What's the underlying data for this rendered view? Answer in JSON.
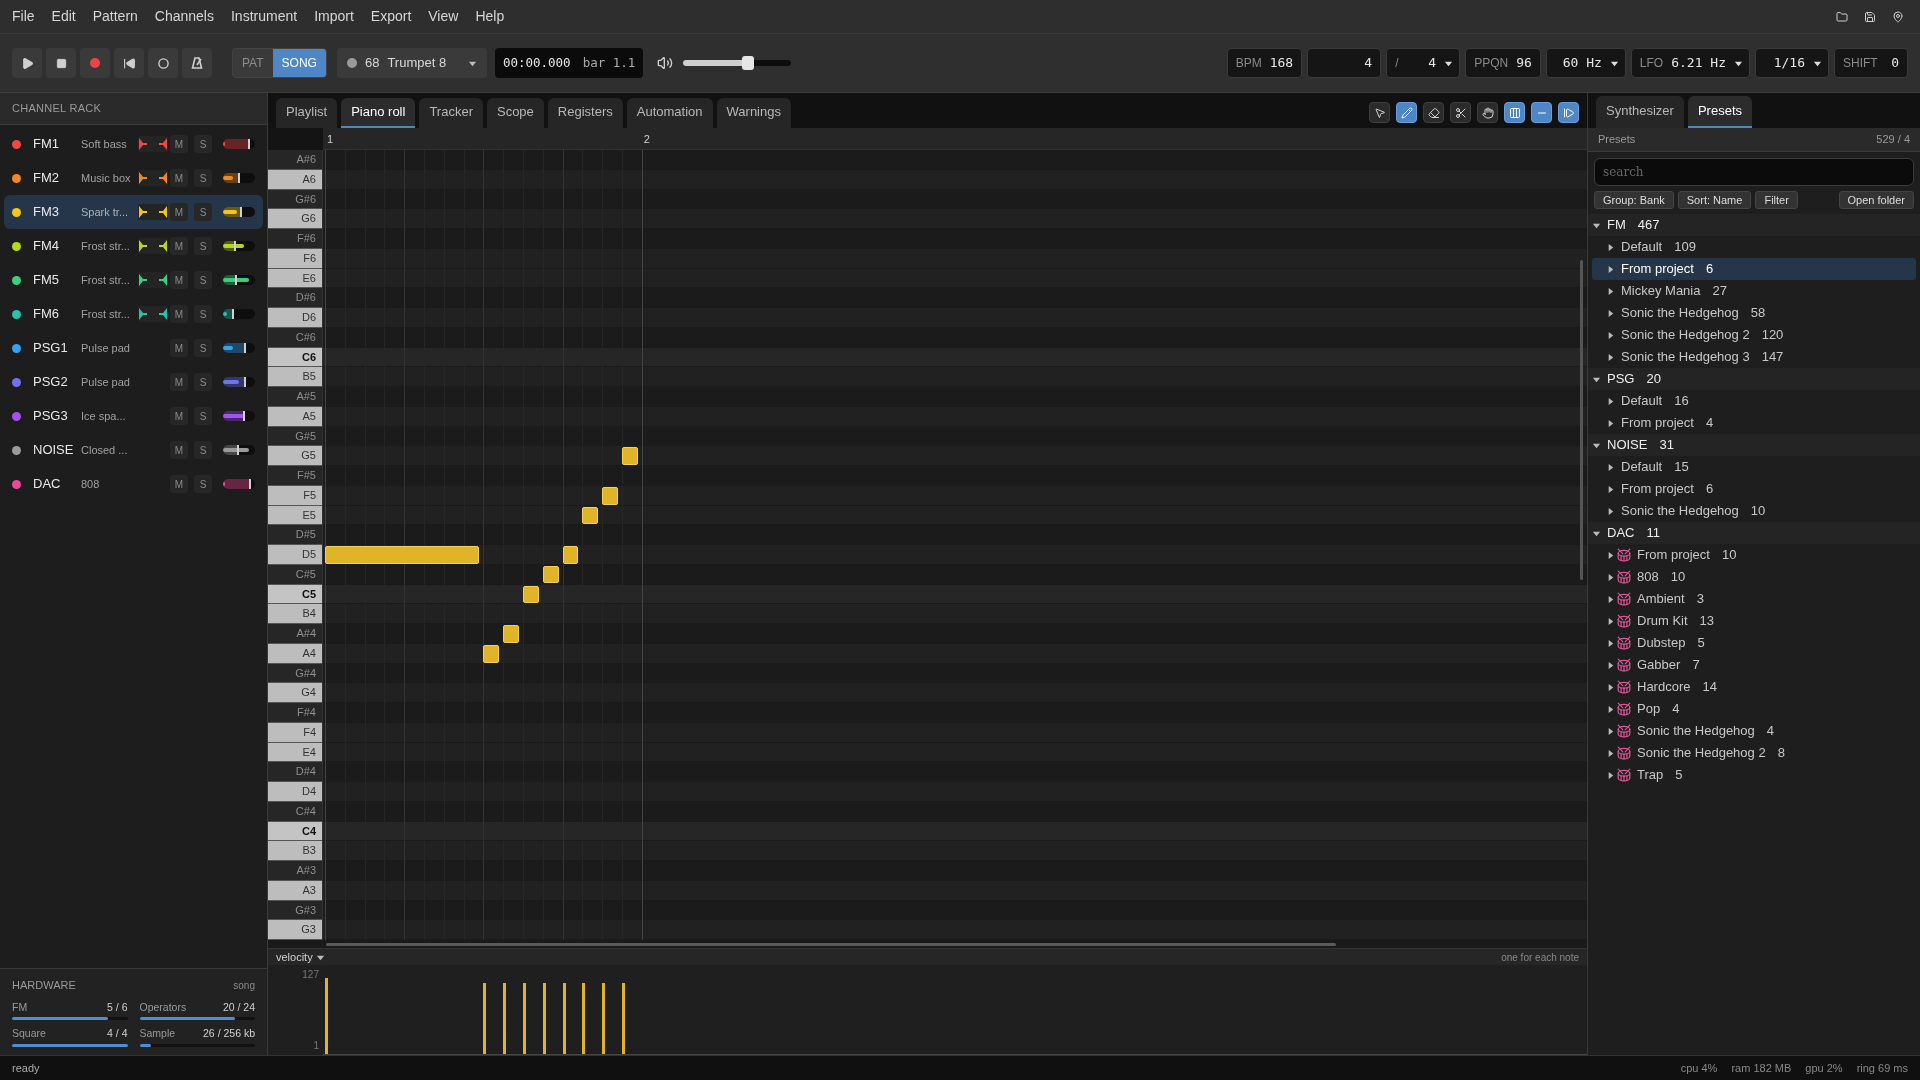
{
  "menu": [
    "File",
    "Edit",
    "Pattern",
    "Channels",
    "Instrument",
    "Import",
    "Export",
    "View",
    "Help"
  ],
  "transport": {
    "mode": [
      {
        "label": "PAT",
        "selected": false
      },
      {
        "label": "SONG",
        "selected": true
      }
    ],
    "instrument": {
      "number": "68",
      "name": "Trumpet 8"
    },
    "time": "00:00.000",
    "bar": "bar 1.1",
    "volume": {
      "level": 0.6
    }
  },
  "settings": [
    {
      "label": "BPM",
      "value": "168",
      "dropdown": false
    },
    {
      "value": "4",
      "dropdown": false
    },
    {
      "label": "/",
      "value": "4",
      "dropdown": true
    },
    {
      "label": "PPQN",
      "value": "96",
      "dropdown": false
    },
    {
      "value": "60 Hz",
      "dropdown": true
    },
    {
      "label": "LFO",
      "value": "6.21 Hz",
      "dropdown": true
    },
    {
      "value": "1/16",
      "dropdown": true
    },
    {
      "label": "SHIFT",
      "value": "0",
      "dropdown": false
    }
  ],
  "channel_rack": {
    "title": "CHANNEL RACK",
    "channels": [
      {
        "name": "FM1",
        "instrument": "Soft bass",
        "color": "#f04848",
        "kind": "fm",
        "selected": false,
        "mute": {
          "label": "M",
          "on": false
        },
        "solo": {
          "label": "S",
          "on": false
        },
        "volume": {
          "level": 0.8
        },
        "meter": {
          "level": 0.06
        }
      },
      {
        "name": "FM2",
        "instrument": "Music box",
        "color": "#f08a24",
        "kind": "fm",
        "selected": false,
        "mute": {
          "label": "M",
          "on": false
        },
        "solo": {
          "label": "S",
          "on": false
        },
        "volume": {
          "level": 0.5
        },
        "meter": {
          "level": 0.3
        }
      },
      {
        "name": "FM3",
        "instrument": "Spark tr...",
        "color": "#f5c518",
        "kind": "fm",
        "selected": true,
        "mute": {
          "label": "M",
          "on": false
        },
        "solo": {
          "label": "S",
          "on": false
        },
        "volume": {
          "level": 0.55
        },
        "meter": {
          "level": 0.45
        }
      },
      {
        "name": "FM4",
        "instrument": "Frost str...",
        "color": "#b5d91f",
        "kind": "fm",
        "selected": false,
        "mute": {
          "label": "M",
          "on": false
        },
        "solo": {
          "label": "S",
          "on": false
        },
        "volume": {
          "level": 0.37
        },
        "meter": {
          "level": 0.65
        }
      },
      {
        "name": "FM5",
        "instrument": "Frost str...",
        "color": "#3ecf7e",
        "kind": "fm",
        "selected": false,
        "mute": {
          "label": "M",
          "on": false
        },
        "solo": {
          "label": "S",
          "on": false
        },
        "volume": {
          "level": 0.4
        },
        "meter": {
          "level": 0.8
        }
      },
      {
        "name": "FM6",
        "instrument": "Frost str...",
        "color": "#2bbfae",
        "kind": "fm",
        "selected": false,
        "mute": {
          "label": "M",
          "on": false
        },
        "solo": {
          "label": "S",
          "on": false
        },
        "volume": {
          "level": 0.3
        },
        "meter": {
          "level": 0.12
        }
      },
      {
        "name": "PSG1",
        "instrument": "Pulse pad",
        "color": "#36a3ef",
        "kind": "psg",
        "selected": false,
        "mute": {
          "label": "M",
          "on": false
        },
        "solo": {
          "label": "S",
          "on": false
        },
        "volume": {
          "level": 0.7
        },
        "meter": {
          "level": 0.3
        }
      },
      {
        "name": "PSG2",
        "instrument": "Pulse pad",
        "color": "#6c74ef",
        "kind": "psg",
        "selected": false,
        "mute": {
          "label": "M",
          "on": false
        },
        "solo": {
          "label": "S",
          "on": false
        },
        "volume": {
          "level": 0.7
        },
        "meter": {
          "level": 0.5
        }
      },
      {
        "name": "PSG3",
        "instrument": "Ice spa...",
        "color": "#a352ef",
        "kind": "psg",
        "selected": false,
        "mute": {
          "label": "M",
          "on": false
        },
        "solo": {
          "label": "S",
          "on": false
        },
        "volume": {
          "level": 0.65
        },
        "meter": {
          "level": 0.65
        }
      },
      {
        "name": "NOISE",
        "instrument": "Closed ...",
        "color": "#9a9a9a",
        "kind": "psg",
        "selected": false,
        "mute": {
          "label": "M",
          "on": false
        },
        "solo": {
          "label": "S",
          "on": false
        },
        "volume": {
          "level": 0.47
        },
        "meter": {
          "level": 0.8
        }
      },
      {
        "name": "DAC",
        "instrument": "808",
        "color": "#ec4899",
        "kind": "psg",
        "selected": false,
        "mute": {
          "label": "M",
          "on": false
        },
        "solo": {
          "label": "S",
          "on": false
        },
        "volume": {
          "level": 0.85
        },
        "meter": {
          "level": 0.06
        }
      }
    ]
  },
  "hardware": {
    "title": "HARDWARE",
    "mode": "song",
    "stats": [
      {
        "label": "FM",
        "value": "5 / 6",
        "level": 0.83
      },
      {
        "label": "Operators",
        "value": "20 / 24",
        "level": 0.83
      },
      {
        "label": "Square",
        "value": "4 / 4",
        "level": 1
      },
      {
        "label": "Sample",
        "value": "26 / 256 kb",
        "level": 0.1
      }
    ]
  },
  "editor_tabs": [
    {
      "label": "Playlist",
      "selected": false
    },
    {
      "label": "Piano roll",
      "selected": true
    },
    {
      "label": "Tracker",
      "selected": false
    },
    {
      "label": "Scope",
      "selected": false
    },
    {
      "label": "Registers",
      "selected": false
    },
    {
      "label": "Automation",
      "selected": false
    },
    {
      "label": "Warnings",
      "selected": false
    }
  ],
  "tools": [
    {
      "kind": "pointer",
      "selected": false
    },
    {
      "kind": "pencil",
      "selected": true
    },
    {
      "kind": "eraser",
      "selected": false
    },
    {
      "kind": "cut",
      "selected": false
    },
    {
      "kind": "hand",
      "selected": false
    },
    {
      "kind": "columns",
      "selected": true
    },
    {
      "kind": "strip",
      "selected": true
    },
    {
      "kind": "follow",
      "selected": true
    }
  ],
  "ruler": [
    "1",
    "2"
  ],
  "keys": [
    {
      "name": "A#6",
      "kind": "black"
    },
    {
      "name": "A6",
      "kind": "white"
    },
    {
      "name": "G#6",
      "kind": "black"
    },
    {
      "name": "G6",
      "kind": "white"
    },
    {
      "name": "F#6",
      "kind": "black"
    },
    {
      "name": "F6",
      "kind": "white"
    },
    {
      "name": "E6",
      "kind": "white"
    },
    {
      "name": "D#6",
      "kind": "black"
    },
    {
      "name": "D6",
      "kind": "white"
    },
    {
      "name": "C#6",
      "kind": "black"
    },
    {
      "name": "C6",
      "kind": "octave"
    },
    {
      "name": "B5",
      "kind": "white"
    },
    {
      "name": "A#5",
      "kind": "black"
    },
    {
      "name": "A5",
      "kind": "white"
    },
    {
      "name": "G#5",
      "kind": "black"
    },
    {
      "name": "G5",
      "kind": "white"
    },
    {
      "name": "F#5",
      "kind": "black"
    },
    {
      "name": "F5",
      "kind": "white"
    },
    {
      "name": "E5",
      "kind": "white"
    },
    {
      "name": "D#5",
      "kind": "black"
    },
    {
      "name": "D5",
      "kind": "white"
    },
    {
      "name": "C#5",
      "kind": "black"
    },
    {
      "name": "C5",
      "kind": "octave"
    },
    {
      "name": "B4",
      "kind": "white"
    },
    {
      "name": "A#4",
      "kind": "black"
    },
    {
      "name": "A4",
      "kind": "white"
    },
    {
      "name": "G#4",
      "kind": "black"
    },
    {
      "name": "G4",
      "kind": "white"
    },
    {
      "name": "F#4",
      "kind": "black"
    },
    {
      "name": "F4",
      "kind": "white"
    },
    {
      "name": "E4",
      "kind": "white"
    },
    {
      "name": "D#4",
      "kind": "black"
    },
    {
      "name": "D4",
      "kind": "white"
    },
    {
      "name": "C#4",
      "kind": "black"
    },
    {
      "name": "C4",
      "kind": "octave"
    },
    {
      "name": "B3",
      "kind": "white"
    },
    {
      "name": "A#3",
      "kind": "black"
    },
    {
      "name": "A3",
      "kind": "white"
    },
    {
      "name": "G#3",
      "kind": "black"
    },
    {
      "name": "G3",
      "kind": "white"
    }
  ],
  "velocity": {
    "label": "velocity",
    "hint": "one for each note",
    "ymax": "127",
    "ymin": "1"
  },
  "side_tabs": [
    {
      "label": "Synthesizer",
      "selected": false
    },
    {
      "label": "Presets",
      "selected": true
    }
  ],
  "presets": {
    "title": "Presets",
    "count": "529 / 4",
    "search": {
      "placeholder": "search"
    },
    "buttons": [
      "Group: Bank",
      "Sort: Name",
      "Filter"
    ],
    "open_folder": "Open folder",
    "groups": [
      {
        "name": "FM",
        "count": "467",
        "expanded": true,
        "children": [
          {
            "name": "Default",
            "count": "109",
            "kind": "bank",
            "selected": false
          },
          {
            "name": "From project",
            "count": "6",
            "kind": "bank",
            "selected": true
          },
          {
            "name": "Mickey Mania",
            "count": "27",
            "kind": "bank",
            "selected": false
          },
          {
            "name": "Sonic the Hedgehog",
            "count": "58",
            "kind": "bank",
            "selected": false
          },
          {
            "name": "Sonic the Hedgehog 2",
            "count": "120",
            "kind": "bank",
            "selected": false
          },
          {
            "name": "Sonic the Hedgehog 3",
            "count": "147",
            "kind": "bank",
            "selected": false
          }
        ]
      },
      {
        "name": "PSG",
        "count": "20",
        "expanded": true,
        "children": [
          {
            "name": "Default",
            "count": "16",
            "kind": "bank",
            "selected": false
          },
          {
            "name": "From project",
            "count": "4",
            "kind": "bank",
            "selected": false
          }
        ]
      },
      {
        "name": "NOISE",
        "count": "31",
        "expanded": true,
        "children": [
          {
            "name": "Default",
            "count": "15",
            "kind": "bank",
            "selected": false
          },
          {
            "name": "From project",
            "count": "6",
            "kind": "bank",
            "selected": false
          },
          {
            "name": "Sonic the Hedgehog",
            "count": "10",
            "kind": "bank",
            "selected": false
          }
        ]
      },
      {
        "name": "DAC",
        "count": "11",
        "expanded": true,
        "children": [
          {
            "name": "From project",
            "count": "10",
            "kind": "drums",
            "selected": false
          },
          {
            "name": "808",
            "count": "10",
            "kind": "drums",
            "selected": false
          },
          {
            "name": "Ambient",
            "count": "3",
            "kind": "drums",
            "selected": false
          },
          {
            "name": "Drum Kit",
            "count": "13",
            "kind": "drums",
            "selected": false
          },
          {
            "name": "Dubstep",
            "count": "5",
            "kind": "drums",
            "selected": false
          },
          {
            "name": "Gabber",
            "count": "7",
            "kind": "drums",
            "selected": false
          },
          {
            "name": "Hardcore",
            "count": "14",
            "kind": "drums",
            "selected": false
          },
          {
            "name": "Pop",
            "count": "4",
            "kind": "drums",
            "selected": false
          },
          {
            "name": "Sonic the Hedgehog",
            "count": "4",
            "kind": "drums",
            "selected": false
          },
          {
            "name": "Sonic the Hedgehog 2",
            "count": "8",
            "kind": "drums",
            "selected": false
          },
          {
            "name": "Trap",
            "count": "5",
            "kind": "drums",
            "selected": false
          }
        ]
      }
    ]
  },
  "status_bar": {
    "message": "ready",
    "stats": [
      "cpu 4%",
      "ram 182 MB",
      "gpu 2%",
      "ring 69 ms"
    ]
  }
}
